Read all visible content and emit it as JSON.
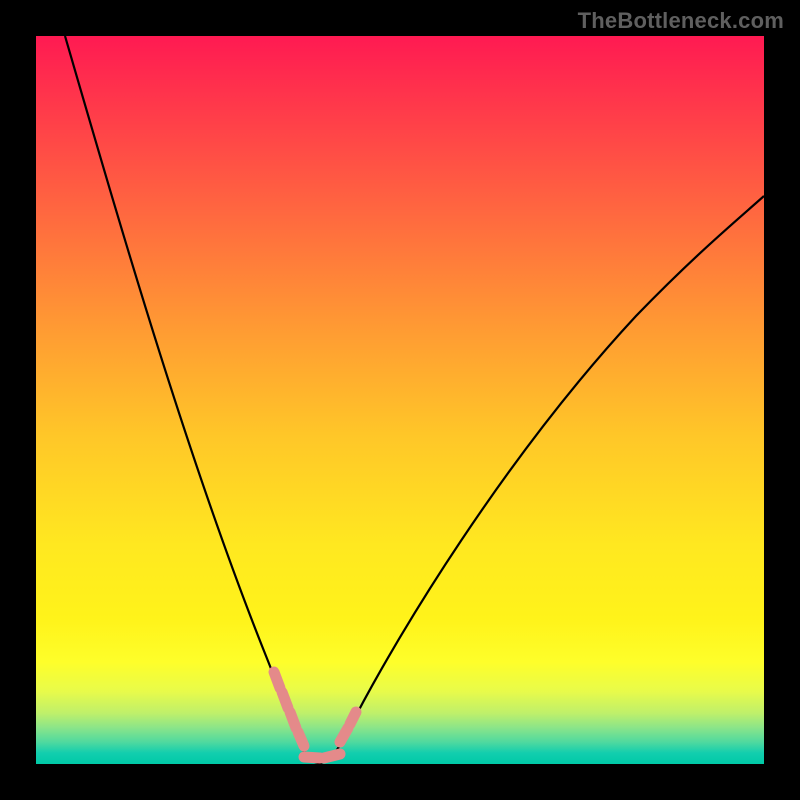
{
  "watermark": {
    "text": "TheBottleneck.com"
  },
  "chart_data": {
    "type": "line",
    "title": "",
    "xlabel": "",
    "ylabel": "",
    "xlim": [
      0,
      100
    ],
    "ylim": [
      0,
      100
    ],
    "grid": false,
    "legend": false,
    "series": [
      {
        "name": "bottleneck-curve",
        "color": "#000000",
        "x": [
          4,
          8,
          12,
          16,
          20,
          24,
          28,
          30,
          32,
          33.5,
          35,
          36,
          37,
          38,
          39,
          40,
          42,
          45,
          50,
          55,
          60,
          65,
          70,
          75,
          80,
          85,
          90,
          95,
          100
        ],
        "y": [
          100,
          84,
          70,
          58,
          47,
          37,
          27,
          22,
          16,
          10,
          5,
          2,
          0,
          0,
          0,
          1,
          4,
          10,
          19,
          27,
          34,
          40,
          46,
          51,
          56,
          60,
          64,
          68,
          71
        ]
      }
    ],
    "markers": [
      {
        "name": "range-highlight",
        "color": "#e48a8a",
        "points": [
          {
            "x": 32.5,
            "y": 12
          },
          {
            "x": 33.0,
            "y": 10
          },
          {
            "x": 33.5,
            "y": 8
          },
          {
            "x": 34.0,
            "y": 6
          },
          {
            "x": 36.0,
            "y": 1
          },
          {
            "x": 37.0,
            "y": 0
          },
          {
            "x": 38.0,
            "y": 0
          },
          {
            "x": 39.0,
            "y": 0
          },
          {
            "x": 40.0,
            "y": 1
          },
          {
            "x": 42.0,
            "y": 4
          },
          {
            "x": 43.0,
            "y": 6
          },
          {
            "x": 43.5,
            "y": 7
          }
        ]
      }
    ],
    "gradient_stops": [
      {
        "pos": 0.0,
        "color": "#ff1a52"
      },
      {
        "pos": 0.4,
        "color": "#ff9a33"
      },
      {
        "pos": 0.8,
        "color": "#fff31a"
      },
      {
        "pos": 1.0,
        "color": "#00c9a7"
      }
    ]
  }
}
